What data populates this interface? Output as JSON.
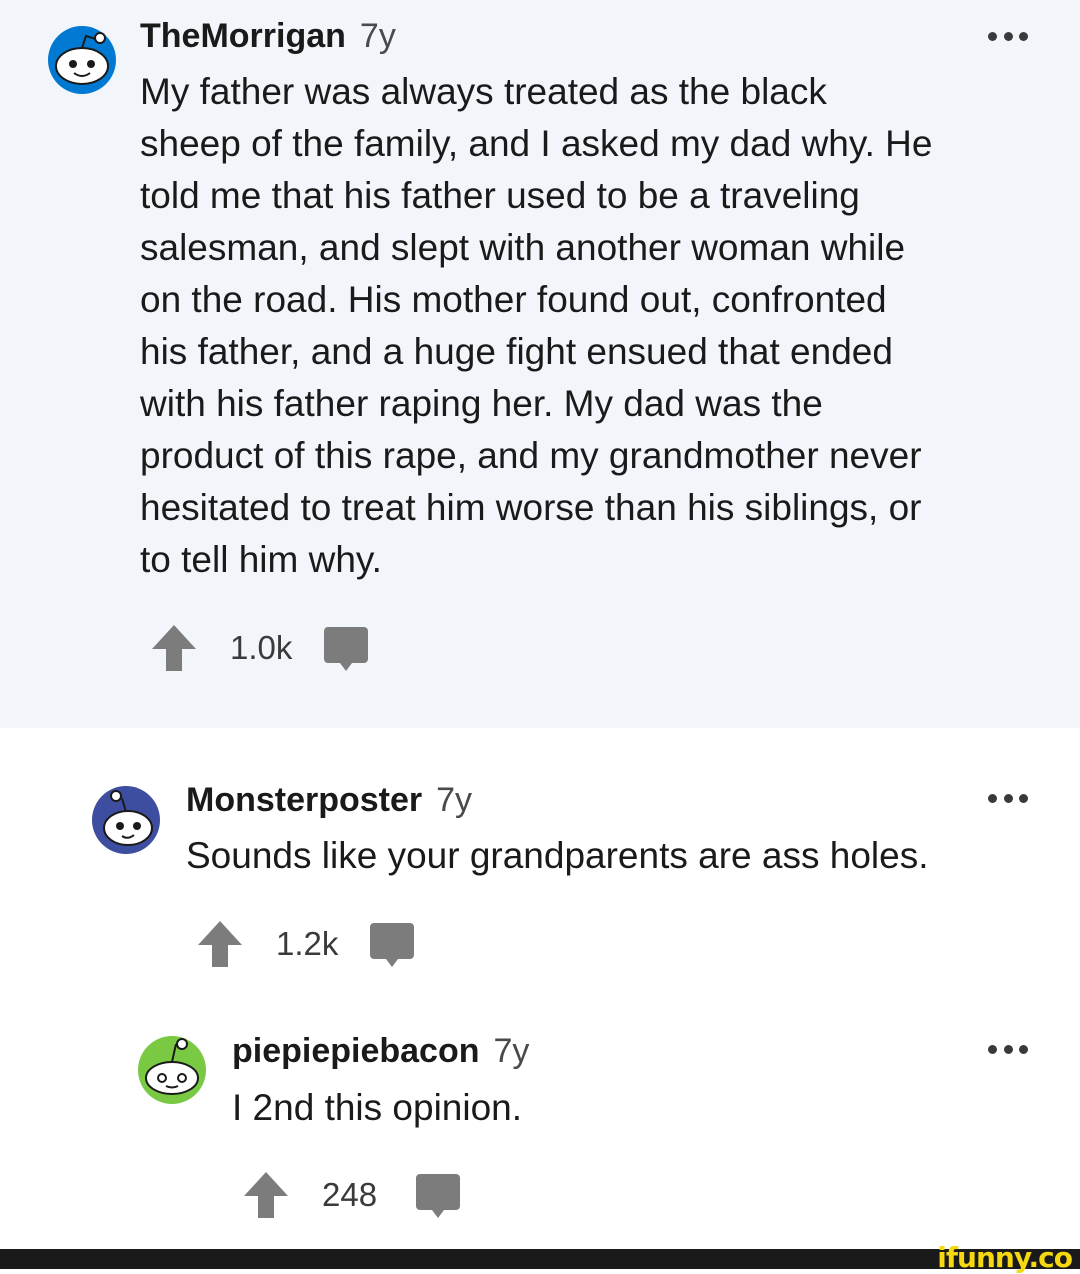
{
  "comments": [
    {
      "username": "TheMorrigan",
      "age": "7y",
      "text": "My father was always treated as the black\nsheep of the family, and I asked my dad why. He\ntold me that his father used to be a traveling\nsalesman, and slept with another woman while\non the road. His mother found out, confronted\nhis father, and a huge fight ensued that ended\nwith his father raping her. My dad was the\nproduct of this rape, and my grandmother never\nhesitated to treat him worse than his siblings, or\nto tell him why.",
      "score": "1.0k",
      "avatar_color": "#0079d3",
      "highlighted": true
    },
    {
      "username": "Monsterposter",
      "age": "7y",
      "text": "Sounds like your grandparents are ass holes.",
      "score": "1.2k",
      "avatar_color": "#3d4ea0"
    },
    {
      "username": "piepiepiebacon",
      "age": "7y",
      "text": "I 2nd this opinion.",
      "score": "248",
      "avatar_color": "#7ac943"
    }
  ],
  "icons": {
    "upvote": "upvote-arrow-icon",
    "reply": "speech-bubble-icon",
    "more": "more-options-icon",
    "avatar": "snoo-avatar-icon"
  },
  "colors": {
    "highlight_background": "#f2f6fb",
    "icon_gray": "#7c7c7c",
    "watermark": "#f5d80f"
  },
  "watermark": "ifunny.co"
}
